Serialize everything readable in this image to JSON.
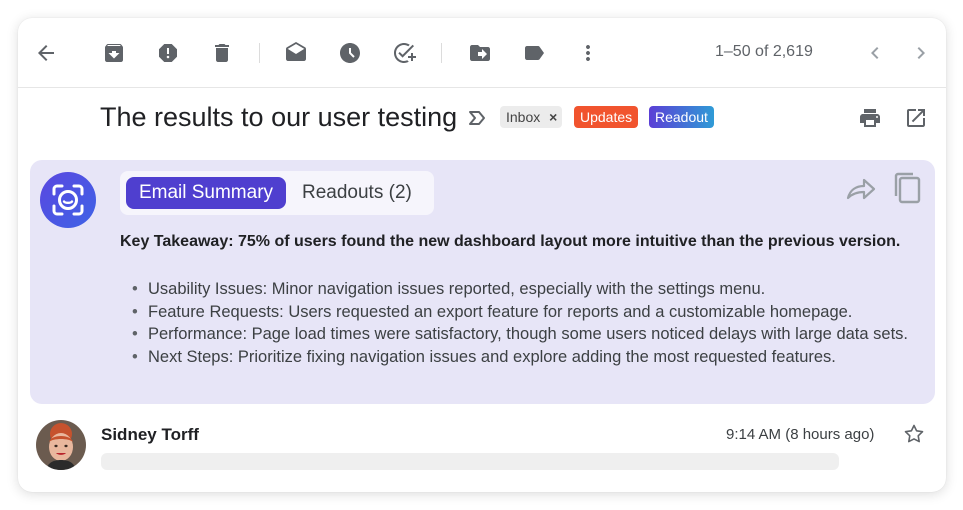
{
  "toolbar": {
    "icons": [
      "back-arrow-icon",
      "archive-icon",
      "report-spam-icon",
      "delete-icon",
      "mark-unread-icon",
      "snooze-icon",
      "add-task-icon",
      "move-to-icon",
      "label-icon",
      "more-vert-icon"
    ],
    "pager_text": "1–50 of 2,619",
    "pager_icons": [
      "chevron-left-icon",
      "chevron-right-icon"
    ]
  },
  "email": {
    "subject": "The results to our user testing",
    "labels": {
      "inbox": "Inbox",
      "inbox_remove": "×",
      "updates": "Updates",
      "readout": "Readout"
    },
    "label_colors": {
      "updates": "#f1542e",
      "readout_start": "#5b3fd6",
      "readout_end": "#2f9bd6"
    }
  },
  "summary": {
    "tabs": {
      "active": "Email Summary",
      "inactive": "Readouts (2)"
    },
    "accent_color": "#4f3fcf",
    "panel_color": "#e7e5f7",
    "takeaway": "Key Takeaway: 75% of users found the new dashboard layout more intuitive than the previous version.",
    "bullets": [
      "Usability Issues: Minor navigation issues reported, especially with the settings menu.",
      "Feature Requests: Users requested an export feature for reports and a customizable homepage.",
      "Performance: Page load times were satisfactory, though some users noticed delays with large data sets.",
      "Next Steps: Prioritize fixing navigation issues and explore adding the most requested features."
    ]
  },
  "message": {
    "sender": "Sidney Torff",
    "timestamp": "9:14 AM  (8 hours ago)"
  }
}
